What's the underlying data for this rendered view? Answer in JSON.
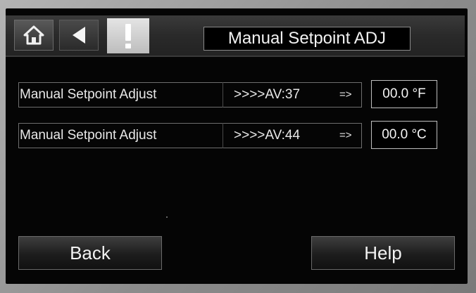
{
  "header": {
    "title": "Manual Setpoint ADJ",
    "home_icon": "home-icon",
    "back_icon": "back-arrow-icon",
    "alarm_icon": "alarm-exclamation-icon"
  },
  "rows": [
    {
      "label": "Manual Setpoint Adjust",
      "reference": ">>>>AV:37",
      "arrow": "=>",
      "value": "00.0 °F"
    },
    {
      "label": "Manual Setpoint Adjust",
      "reference": ">>>>AV:44",
      "arrow": "=>",
      "value": "00.0 °C"
    }
  ],
  "footer": {
    "back_label": "Back",
    "help_label": "Help"
  },
  "colors": {
    "screen_background": "#050505",
    "alarm_button": "#d9d9d9",
    "text": "#f2f2f2"
  }
}
